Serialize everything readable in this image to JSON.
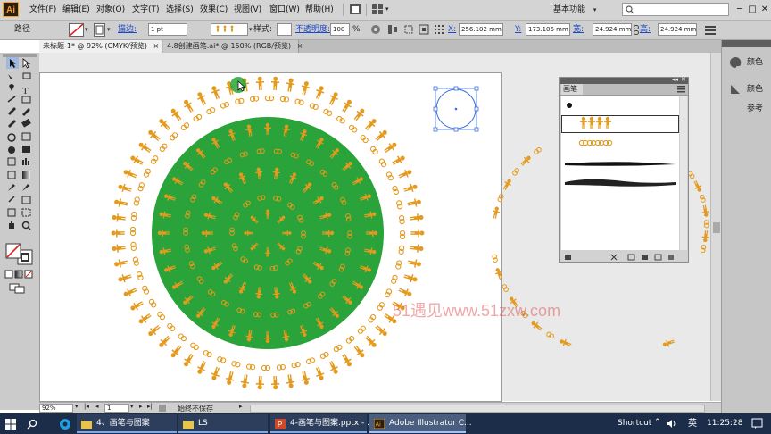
{
  "app": {
    "logo_text": "Ai"
  },
  "menubar": {
    "items": [
      "文件(F)",
      "编辑(E)",
      "对象(O)",
      "文字(T)",
      "选择(S)",
      "效果(C)",
      "视图(V)",
      "窗口(W)",
      "帮助(H)"
    ],
    "workspace_label": "基本功能",
    "window_controls": [
      "─",
      "□",
      "✕"
    ]
  },
  "controlbar": {
    "object_type": "路径",
    "stroke_label": "描边:",
    "stroke_weight": "1 pt",
    "style_label": "样式:",
    "opacity_label": "不透明度:",
    "opacity_value": "100",
    "opacity_unit": "%",
    "x_label": "X:",
    "x_value": "256.102 mm",
    "y_label": "Y:",
    "y_value": "173.106 mm",
    "w_label": "宽:",
    "w_value": "24.924 mm",
    "h_label": "高:",
    "h_value": "24.924 mm"
  },
  "tabs": [
    {
      "label": "未标题-1* @ 92% (CMYK/预览)",
      "close": "×",
      "active": true
    },
    {
      "label": "4.8创建画笔.ai* @ 150% (RGB/预览)",
      "close": "×",
      "active": false
    }
  ],
  "statusbar": {
    "zoom": "92%",
    "page": "1",
    "status": "始终不保存"
  },
  "brush_panel": {
    "title": "画笔",
    "collapse": "◂◂",
    "close": "✕"
  },
  "dock": {
    "items": [
      {
        "label": "颜色",
        "icon": "color-palette-icon"
      },
      {
        "label": "颜色参考",
        "icon": "color-guide-icon"
      }
    ]
  },
  "watermark": "51遇见www.51zxw.com",
  "taskbar": {
    "items": [
      {
        "label": "4、画笔与图案",
        "icon": "folder-icon"
      },
      {
        "label": "LS",
        "icon": "folder-icon"
      },
      {
        "label": "4-画笔与图案.pptx - ...",
        "icon": "powerpoint-icon"
      },
      {
        "label": "Adobe Illustrator C...",
        "icon": "illustrator-icon"
      }
    ],
    "shortcut": "Shortcut",
    "ime": "英",
    "time": "11:25:28"
  },
  "colors": {
    "orange": "#e49a1e",
    "green": "#2aa33a",
    "menubar": "#d4d4d4",
    "taskbar": "#1c2d4a"
  }
}
